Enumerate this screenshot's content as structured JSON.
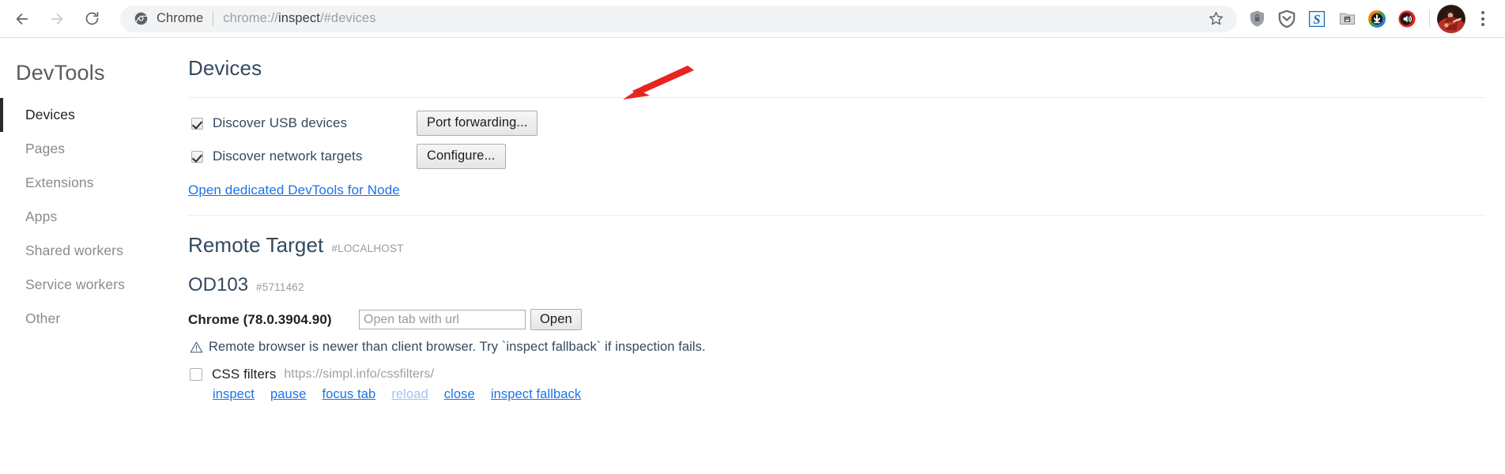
{
  "browser": {
    "nav": {
      "back_icon": "arrow-left-icon",
      "forward_icon": "arrow-right-icon",
      "reload_icon": "reload-icon"
    },
    "omnibox": {
      "chrome_logo_icon": "chrome-logo-icon",
      "scheme_label": "Chrome",
      "url_prefix": "chrome://",
      "url_emphasis": "inspect",
      "url_suffix": "/#devices",
      "bookmark_icon": "star-outline-icon"
    },
    "extensions": [
      {
        "name": "shield-lock-icon",
        "title": "HTTPS security extension"
      },
      {
        "name": "pocket-icon",
        "title": "Pocket"
      },
      {
        "name": "blue-s-icon",
        "title": "S extension"
      },
      {
        "name": "youtube-downloader-icon",
        "title": "Video downloader"
      },
      {
        "name": "rainbow-download-icon",
        "title": "Download manager"
      },
      {
        "name": "red-speaker-icon",
        "title": "Volume control"
      }
    ],
    "avatar_icon": "profile-avatar",
    "menu_icon": "three-dot-menu-icon"
  },
  "sidebar": {
    "brand": "DevTools",
    "items": [
      {
        "label": "Devices",
        "selected": true
      },
      {
        "label": "Pages",
        "selected": false
      },
      {
        "label": "Extensions",
        "selected": false
      },
      {
        "label": "Apps",
        "selected": false
      },
      {
        "label": "Shared workers",
        "selected": false
      },
      {
        "label": "Service workers",
        "selected": false
      },
      {
        "label": "Other",
        "selected": false
      }
    ]
  },
  "main": {
    "heading": "Devices",
    "discover_usb": {
      "label": "Discover USB devices",
      "checked": true,
      "button": "Port forwarding..."
    },
    "discover_network": {
      "label": "Discover network targets",
      "checked": true,
      "button": "Configure..."
    },
    "node_link": "Open dedicated DevTools for Node",
    "remote_target": {
      "heading": "Remote Target",
      "id": "#LOCALHOST"
    },
    "device": {
      "name": "OD103",
      "serial": "#5711462"
    },
    "browser_row": {
      "version_label": "Chrome (78.0.3904.90)",
      "open_tab_placeholder": "Open tab with url",
      "open_tab_value": "",
      "open_button": "Open"
    },
    "warning": {
      "icon": "warning-triangle-icon",
      "text": "Remote browser is newer than client browser. Try `inspect fallback` if inspection fails."
    },
    "target": {
      "checked": false,
      "title": "CSS filters",
      "url": "https://simpl.info/cssfilters/",
      "actions": [
        {
          "label": "inspect",
          "disabled": false
        },
        {
          "label": "pause",
          "disabled": false
        },
        {
          "label": "focus tab",
          "disabled": false
        },
        {
          "label": "reload",
          "disabled": true
        },
        {
          "label": "close",
          "disabled": false
        },
        {
          "label": "inspect fallback",
          "disabled": false
        }
      ]
    }
  },
  "annotation": {
    "arrow_icon": "red-arrow-annotation",
    "color": "#e8241f"
  },
  "colors": {
    "link": "#1a73e8",
    "heading": "#34495e",
    "muted": "#9b9b9b",
    "annotation_red": "#e8241f"
  }
}
